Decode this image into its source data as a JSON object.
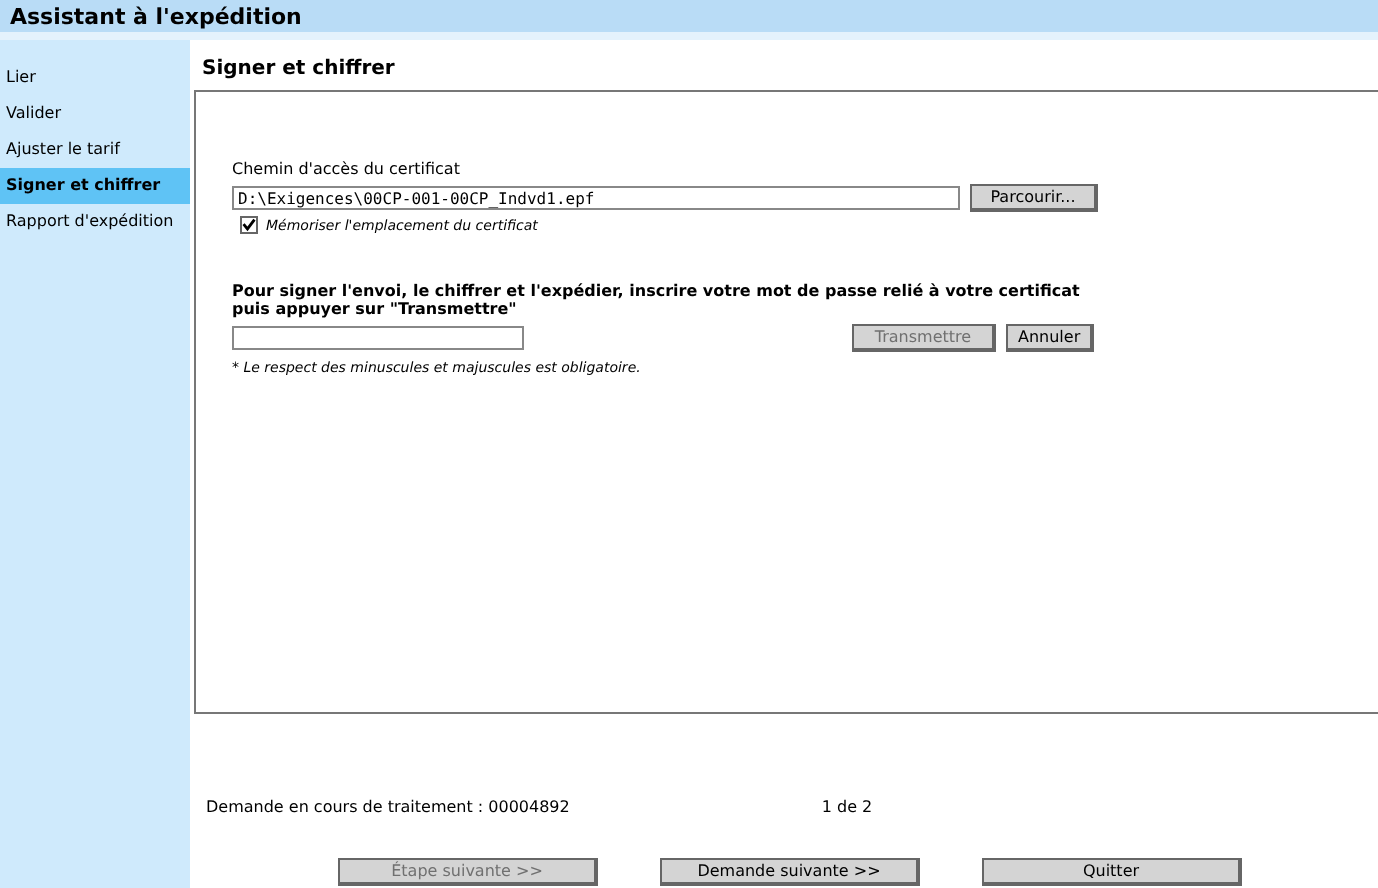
{
  "window": {
    "title": "Assistant à l'expédition"
  },
  "sidebar": {
    "items": [
      {
        "label": "Lier",
        "selected": false
      },
      {
        "label": "Valider",
        "selected": false
      },
      {
        "label": "Ajuster le tarif",
        "selected": false
      },
      {
        "label": "Signer et chiffrer",
        "selected": true
      },
      {
        "label": "Rapport d'expédition",
        "selected": false
      }
    ]
  },
  "page": {
    "heading": "Signer et chiffrer",
    "certificate": {
      "label": "Chemin d'accès du certificat",
      "value": "D:\\Exigences\\00CP-001-00CP_Indvd1.epf",
      "browse_button": "Parcourir...",
      "remember": {
        "label": "Mémoriser l'emplacement du certificat",
        "checked": true
      }
    },
    "password": {
      "instruction": "Pour signer l'envoi, le chiffrer et l'expédier, inscrire votre mot de passe relié à votre certificat puis appuyer sur \"Transmettre\"",
      "buttons": [
        {
          "label": "Transmettre",
          "disabled": true
        },
        {
          "label": "Annuler",
          "disabled": false
        }
      ],
      "note": "* Le respect des minuscules et majuscules est obligatoire."
    }
  },
  "status": {
    "request": "Demande en cours de traitement : 00004892",
    "pager": "1 de 2"
  },
  "footer_buttons": [
    {
      "label": "Étape suivante >>",
      "disabled": true
    },
    {
      "label": "Demande suivante >>",
      "disabled": false
    },
    {
      "label": "Quitter",
      "disabled": false
    }
  ]
}
